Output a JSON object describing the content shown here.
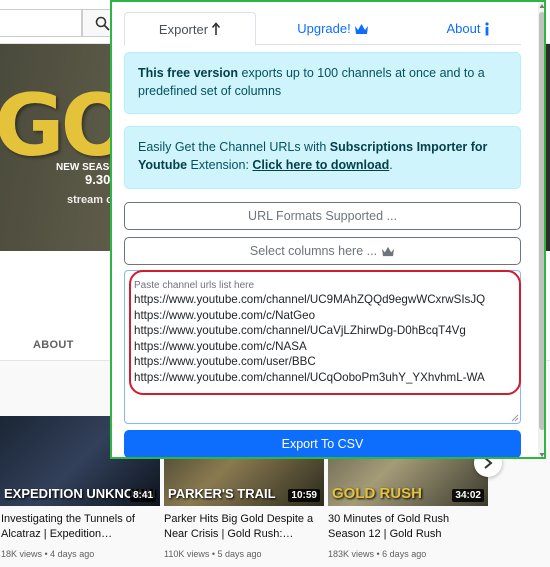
{
  "youtube": {
    "banner": {
      "title": "GOLD",
      "line1": "NEW SEASON",
      "line2": "9.30",
      "line3": "stream o"
    },
    "about_tab": "ABOUT",
    "videos": [
      {
        "title": "Investigating the Tunnels of Alcatraz | Expedition…",
        "meta": "18K views • 4 days ago",
        "duration": "8:41",
        "thumb_text": "EXPEDITION UNKNOWN"
      },
      {
        "title": "Parker Hits Big Gold Despite a Near Crisis | Gold Rush:…",
        "meta": "110K views • 5 days ago",
        "duration": "10:59",
        "thumb_text": "PARKER'S TRAIL"
      },
      {
        "title": "30 Minutes of Gold Rush Season 12 | Gold Rush",
        "meta": "183K views • 6 days ago",
        "duration": "34:02",
        "thumb_text": "GOLD RUSH"
      }
    ]
  },
  "popup": {
    "tabs": [
      {
        "label": "Exporter",
        "icon": "arrow-up-icon",
        "active": true
      },
      {
        "label": "Upgrade!",
        "icon": "crown-icon",
        "active": false
      },
      {
        "label": "About",
        "icon": "info-icon",
        "active": false
      }
    ],
    "free_notice": {
      "bold": "This free version",
      "text": " exports up to 100 channels at once and to a predefined set of columns"
    },
    "importer_notice": {
      "text1": "Easily Get the Channel URLs with ",
      "bold": "Subscriptions Importer for Youtube",
      "text2": " Extension: ",
      "link": "Click here to download",
      "text3": "."
    },
    "formats_button": "URL Formats Supported ...",
    "columns_button": "Select columns here ...",
    "textarea": {
      "placeholder": "Paste channel urls list here",
      "urls": [
        "https://www.youtube.com/channel/UC9MAhZQQd9egwWCxrwSIsJQ",
        "https://www.youtube.com/c/NatGeo",
        "https://www.youtube.com/channel/UCaVjLZhirwDg-D0hBcqT4Vg",
        "https://www.youtube.com/c/NASA",
        "https://www.youtube.com/user/BBC",
        "https://www.youtube.com/channel/UCqOoboPm3uhY_YXhvhmL-WA"
      ]
    },
    "export_button": "Export To CSV"
  },
  "colors": {
    "popup_border": "#2fb544",
    "highlight_ring": "#d21c2c",
    "primary": "#0d6efd",
    "info_bg": "#cff4fc"
  }
}
